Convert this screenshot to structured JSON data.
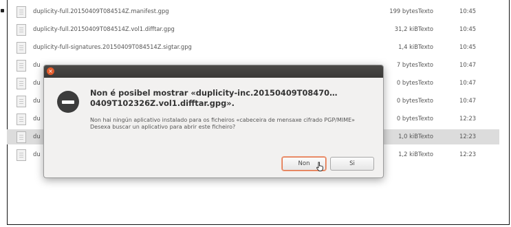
{
  "files": [
    {
      "name": "duplicity-full.20150409T084514Z.manifest.gpg",
      "size": "199 bytes",
      "type": "Texto",
      "time": "10:45"
    },
    {
      "name": "duplicity-full.20150409T084514Z.vol1.difftar.gpg",
      "size": "31,2 kiB",
      "type": "Texto",
      "time": "10:45"
    },
    {
      "name": "duplicity-full-signatures.20150409T084514Z.sigtar.gpg",
      "size": "1,4 kiB",
      "type": "Texto",
      "time": "10:45"
    },
    {
      "name": "du",
      "size": "7 bytes",
      "type": "Texto",
      "time": "10:47"
    },
    {
      "name": "du",
      "size": "0 bytes",
      "type": "Texto",
      "time": "10:47"
    },
    {
      "name": "du",
      "size": "0 bytes",
      "type": "Texto",
      "time": "10:47"
    },
    {
      "name": "du",
      "size": "0 bytes",
      "type": "Texto",
      "time": "12:23"
    },
    {
      "name": "du",
      "size": "1,0 kiB",
      "type": "Texto",
      "time": "12:23"
    },
    {
      "name": "du",
      "size": "1,2 kiB",
      "type": "Texto",
      "time": "12:23"
    }
  ],
  "dialog": {
    "close_glyph": "×",
    "title": "Non é posibel mostrar «duplicity-inc.20150409T08470…0409T102326Z.vol1.difftar.gpg».",
    "body_line1": "Non hai ningún aplicativo instalado para os ficheiros «cabeceira de mensaxe cifrado PGP/MIME»",
    "body_line2": "Desexa buscar un aplicativo para abrir este ficheiro?",
    "no_label": "Non",
    "yes_label": "Si"
  },
  "colors": {
    "close": "#e35b2b",
    "default_button_border": "#e0724a",
    "selection": "#dcdcdc"
  }
}
